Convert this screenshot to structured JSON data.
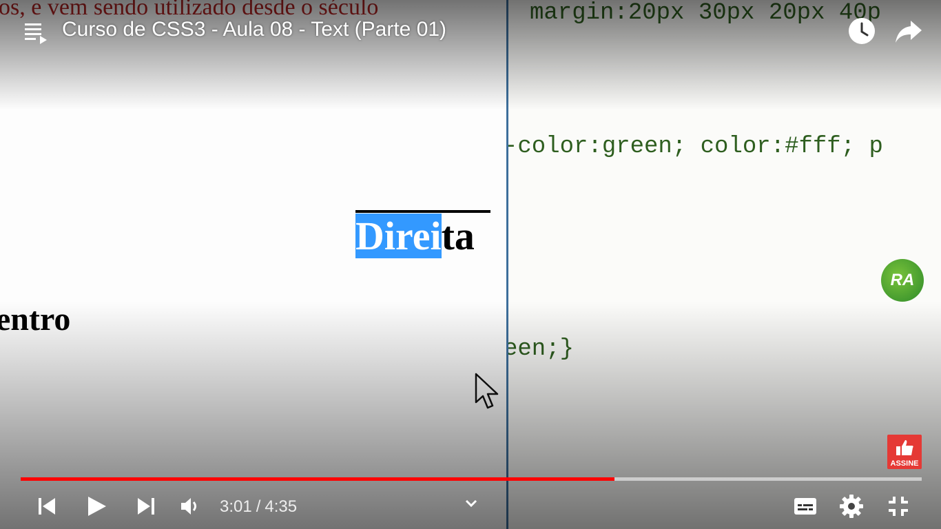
{
  "player": {
    "title": "Curso de CSS3 - Aula 08 - Text (Parte 01)",
    "current_time": "3:01",
    "separator": "/",
    "duration": "4:35",
    "progress_fraction": 0.659,
    "progress_color": "#ff0000",
    "channel_logo_text": "RA",
    "subscribe_label": "ASSINE"
  },
  "icons": {
    "playlist": "playlist-icon",
    "watch_later": "clock-icon",
    "share": "share-icon",
    "previous": "skip-previous-icon",
    "play": "play-icon",
    "next": "skip-next-icon",
    "volume": "volume-icon",
    "expand": "chevron-down-icon",
    "subtitles": "subtitles-icon",
    "settings": "gear-icon",
    "exit_fullscreen": "exit-fullscreen-icon"
  },
  "video_frame": {
    "red_paragraph": "os, e vem sendo utilizado desde o século",
    "direita_selected": "Direi",
    "direita_rest": "ta",
    "centro": "entro",
    "code_line_1": "margin:20px 30px 20px 40p",
    "code_line_2": "-color:green; color:#fff; p",
    "code_line_3": "een;}"
  }
}
